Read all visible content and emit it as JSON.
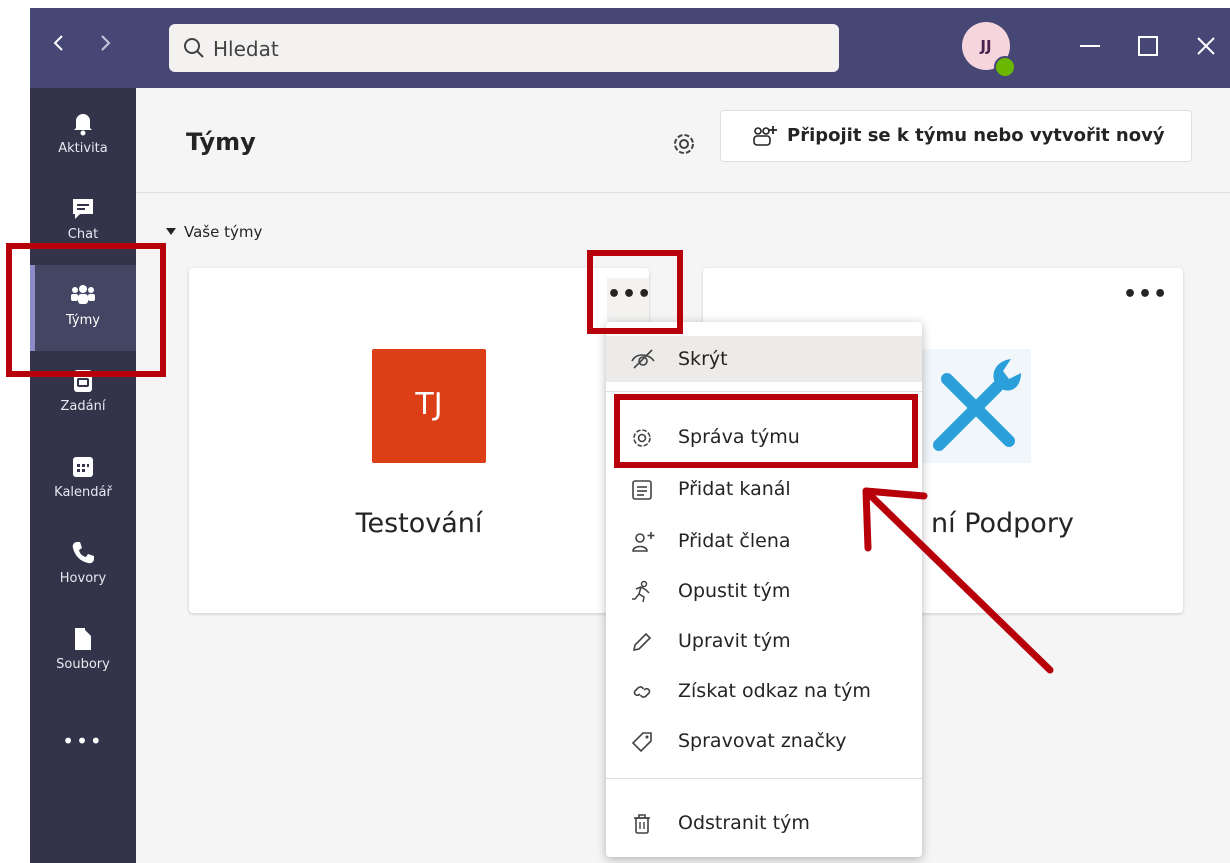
{
  "titlebar": {
    "search_placeholder": "Hledat",
    "avatar_initials": "JJ",
    "presence_color": "#6bb700",
    "back_icon": "chevron-left-icon",
    "forward_icon": "chevron-right-icon"
  },
  "rail": {
    "items": [
      {
        "label": "Aktivita",
        "icon": "bell-icon"
      },
      {
        "label": "Chat",
        "icon": "chat-icon"
      },
      {
        "label": "Týmy",
        "icon": "teams-icon",
        "active": true
      },
      {
        "label": "Zadání",
        "icon": "assignments-icon"
      },
      {
        "label": "Kalendář",
        "icon": "calendar-icon"
      },
      {
        "label": "Hovory",
        "icon": "phone-icon"
      },
      {
        "label": "Soubory",
        "icon": "file-icon"
      }
    ],
    "more_label": "•••"
  },
  "header": {
    "title": "Týmy",
    "join_button_label": "Připojit se k týmu nebo vytvořit nový"
  },
  "section": {
    "label": "Vaše týmy"
  },
  "teams": [
    {
      "name": "Testování",
      "initials": "TJ",
      "color": "#dc3e15"
    },
    {
      "name_visible": "ní Podpory",
      "color": "#f1f6fa"
    }
  ],
  "card_more_label": "•••",
  "menu": {
    "items": [
      {
        "label": "Skrýt",
        "icon": "hide-eye-icon"
      },
      {
        "label": "Správa týmu",
        "icon": "gear-icon"
      },
      {
        "label": "Přidat kanál",
        "icon": "channel-list-icon"
      },
      {
        "label": "Přidat člena",
        "icon": "add-person-icon"
      },
      {
        "label": "Opustit tým",
        "icon": "leave-running-icon"
      },
      {
        "label": "Upravit tým",
        "icon": "pencil-icon"
      },
      {
        "label": "Získat odkaz na tým",
        "icon": "link-icon"
      },
      {
        "label": "Spravovat značky",
        "icon": "tag-icon"
      },
      {
        "label": "Odstranit tým",
        "icon": "trash-icon"
      }
    ]
  },
  "colors": {
    "titlebar": "#464775",
    "rail": "#33344a",
    "annotation": "#b8000a"
  }
}
